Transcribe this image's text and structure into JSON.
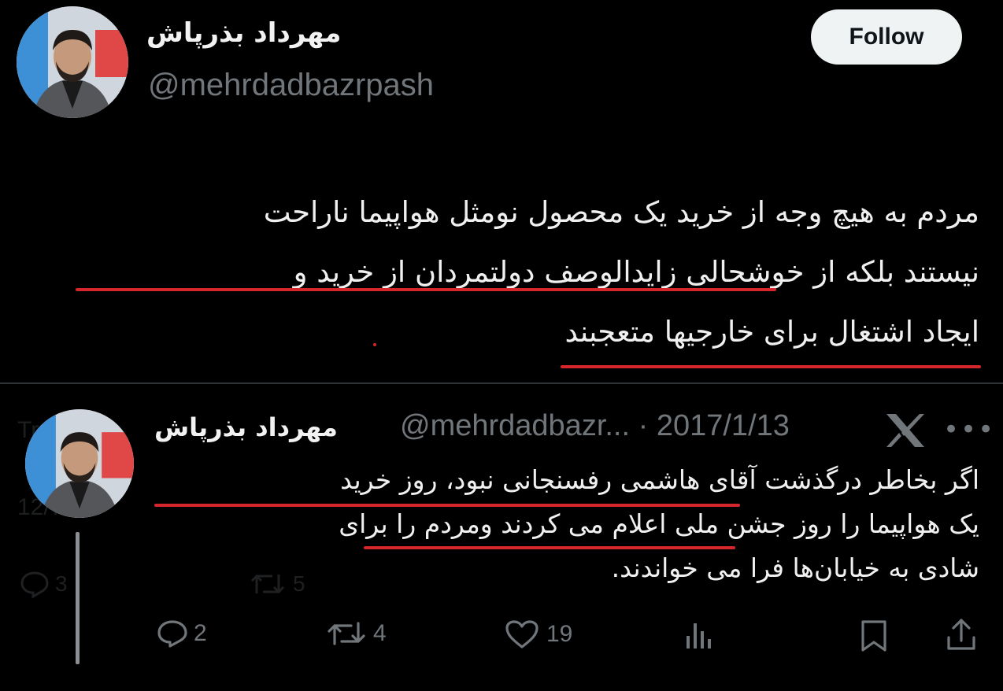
{
  "tweet": {
    "author_name": "مهرداد بذرپاش",
    "author_handle": "@mehrdadbazrpash",
    "follow_label": "Follow",
    "text_lines": [
      "مردم به هیچ وجه از خرید یک محصول نومثل هواپیما ناراحت",
      "نیستند بلکه از خوشحالی زایدالوصف دولتمردان از خرید و",
      "ایجاد اشتغال برای خارجیها متعجبند"
    ]
  },
  "quoted_tweet": {
    "author_name": "مهرداد بذرپاش",
    "author_handle": "@mehrdadbazr...",
    "separator": "·",
    "date": "2017/1/13",
    "text_lines": [
      "اگر بخاطر درگذشت آقای هاشمی رفسنجانی نبود، روز خرید",
      "یک هواپیما را روز جشن ملی اعلام می کردند ومردم را برای",
      "شادی به خیابان‌ها فرا می خواندند."
    ],
    "actions": {
      "replies": "2",
      "retweets": "4",
      "likes": "19"
    }
  },
  "background_ghost": {
    "text_1": "Tr   ate",
    "text_2": "12/7/2    4",
    "replies": "3",
    "retweets": "5"
  },
  "colors": {
    "background": "#000000",
    "underline": "#d4262b",
    "muted": "#71767b",
    "follow_bg": "#eff3f4"
  },
  "icons": [
    "avatar",
    "x-logo-icon",
    "more-icon",
    "reply-icon",
    "retweet-icon",
    "like-icon",
    "views-icon",
    "bookmark-icon",
    "share-icon"
  ]
}
